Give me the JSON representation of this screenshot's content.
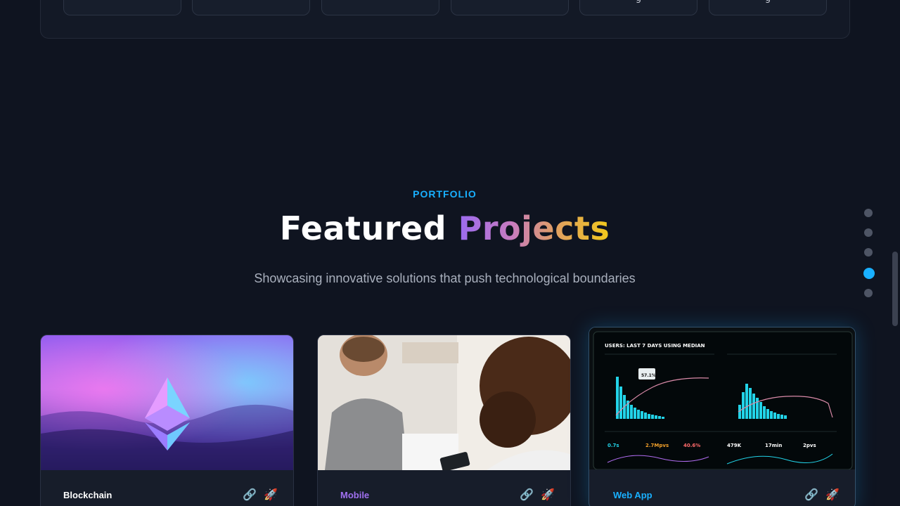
{
  "top_section": {
    "chips": [
      "",
      "",
      "",
      "",
      "g",
      "g"
    ]
  },
  "portfolio": {
    "eyebrow": "PORTFOLIO",
    "title_plain": "Featured",
    "title_gradient": "Projects",
    "subtitle": "Showcasing innovative solutions that push technological boundaries"
  },
  "dot_nav": {
    "count": 5,
    "active_index": 3
  },
  "projects": [
    {
      "category": "Blockchain",
      "category_color": "#ffffff",
      "link_icon": "🔗",
      "launch_icon": "🚀"
    },
    {
      "category": "Mobile",
      "category_color": "#a070f0",
      "link_icon": "🔗",
      "launch_icon": "🚀"
    },
    {
      "category": "Web App",
      "category_color": "#19b0ff",
      "link_icon": "🔗",
      "launch_icon": "🚀"
    }
  ],
  "dashboard": {
    "header": "USERS: LAST 7 DAYS USING MEDIAN",
    "tooltip": "57.1%",
    "metrics": [
      {
        "value": "0.7s"
      },
      {
        "value": "2.7Mpvs"
      },
      {
        "value": "40.6%"
      },
      {
        "value": "479K"
      },
      {
        "value": "17min"
      },
      {
        "value": "2pvs"
      }
    ]
  },
  "colors": {
    "accent": "#19b0ff",
    "background": "#0f1420",
    "card": "#171d2a"
  }
}
